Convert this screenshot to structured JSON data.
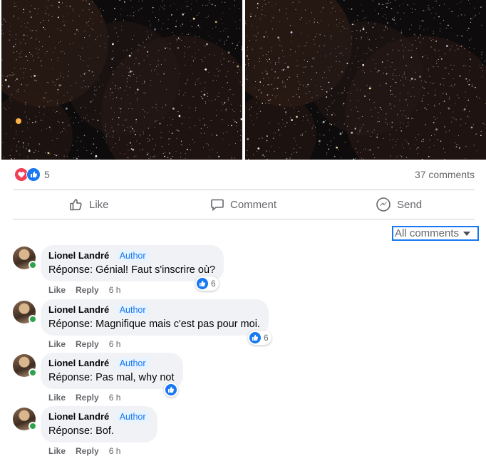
{
  "post": {
    "reaction_count": "5",
    "comments_count": "37 comments",
    "reaction_icons": [
      "heart-icon",
      "like-icon"
    ]
  },
  "actions": {
    "like": "Like",
    "comment": "Comment",
    "send": "Send"
  },
  "filter": {
    "label": "All comments"
  },
  "comments": [
    {
      "author": "Lionel Landré",
      "badge": "Author",
      "text": "Réponse: Génial! Faut s'inscrire où?",
      "like": "Like",
      "reply": "Reply",
      "time": "6 h",
      "reactions": "6"
    },
    {
      "author": "Lionel Landré",
      "badge": "Author",
      "text": "Réponse: Magnifique mais c'est pas pour moi.",
      "like": "Like",
      "reply": "Reply",
      "time": "6 h",
      "reactions": "6"
    },
    {
      "author": "Lionel Landré",
      "badge": "Author",
      "text": "Réponse: Pas mal, why not",
      "like": "Like",
      "reply": "Reply",
      "time": "6 h",
      "reactions": ""
    },
    {
      "author": "Lionel Landré",
      "badge": "Author",
      "text": "Réponse: Bof.",
      "like": "Like",
      "reply": "Reply",
      "time": "6 h",
      "reactions": ""
    }
  ],
  "colors": {
    "accent": "#1877f2",
    "bubble": "#f0f2f5",
    "meta": "#65676b",
    "online": "#31a24c",
    "love": "#f33e58"
  }
}
